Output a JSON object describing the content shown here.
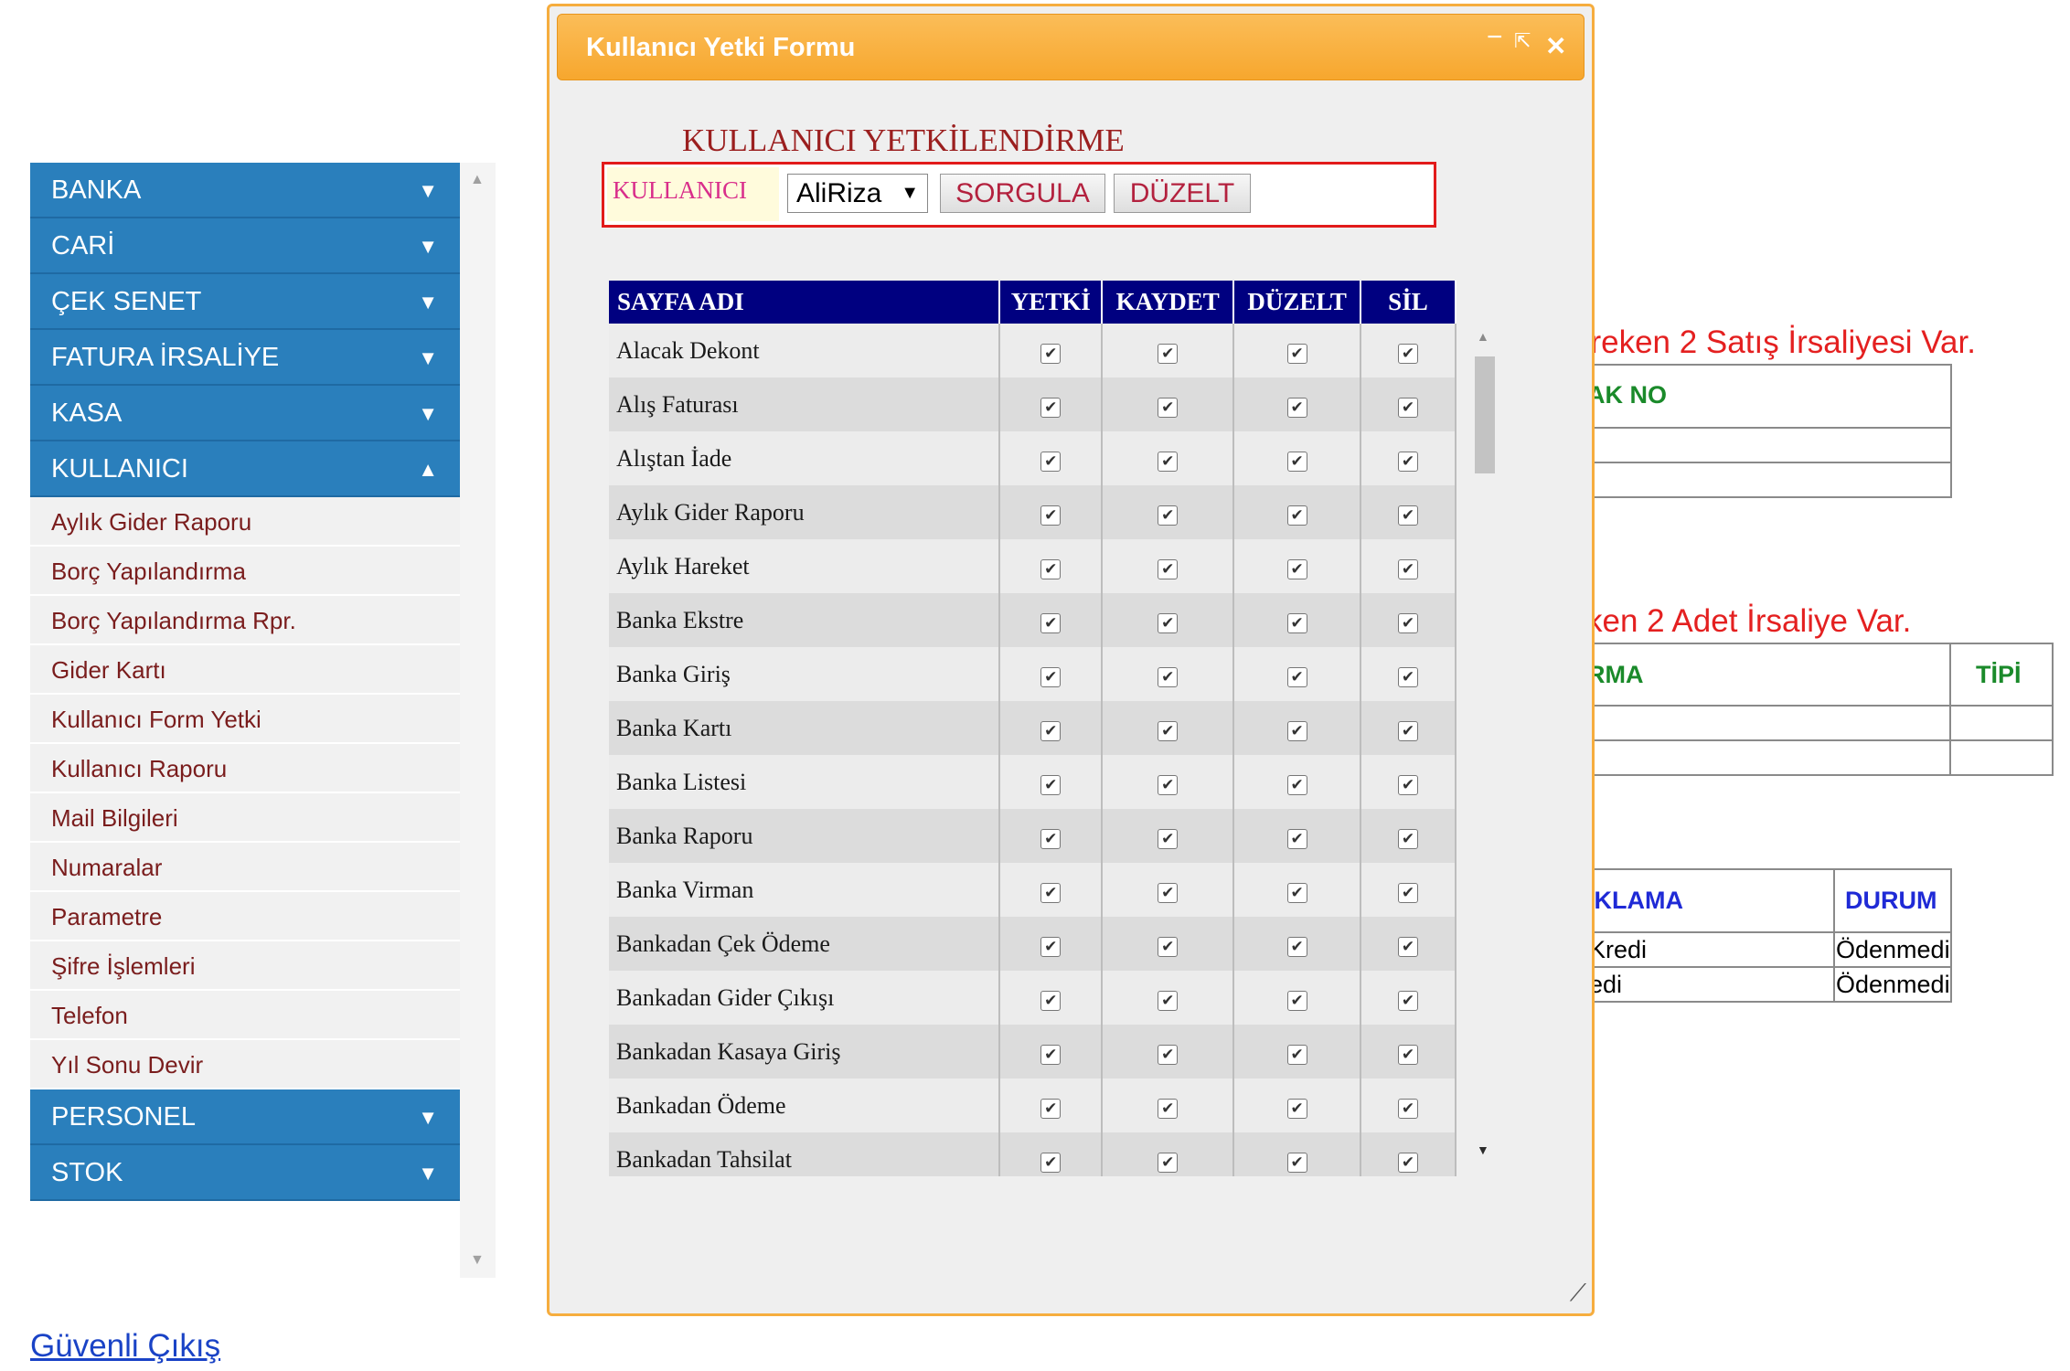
{
  "menu": {
    "sections_top": [
      {
        "label": "BANKA",
        "arrow": "▼"
      },
      {
        "label": "CARİ",
        "arrow": "▼"
      },
      {
        "label": "ÇEK SENET",
        "arrow": "▼"
      },
      {
        "label": "FATURA İRSALİYE",
        "arrow": "▼"
      },
      {
        "label": "KASA",
        "arrow": "▼"
      },
      {
        "label": "KULLANICI",
        "arrow": "▲"
      }
    ],
    "sub_items": [
      "Aylık Gider Raporu",
      "Borç Yapılandırma",
      "Borç Yapılandırma Rpr.",
      "Gider Kartı",
      "Kullanıcı Form Yetki",
      "Kullanıcı Raporu",
      "Mail Bilgileri",
      "Numaralar",
      "Parametre",
      "Şifre İşlemleri",
      "Telefon",
      "Yıl Sonu Devir"
    ],
    "sections_bottom": [
      {
        "label": "PERSONEL",
        "arrow": "▼"
      },
      {
        "label": "STOK",
        "arrow": "▼"
      }
    ]
  },
  "logout": "Güvenli Çıkış",
  "background": {
    "msg1": "ereken 2 Satış İrsaliyesi Var.",
    "table1_header": "AK NO",
    "msg2": "ken 2 Adet İrsaliye Var.",
    "table2_headers": [
      "RMA",
      "TİPİ"
    ],
    "table3_headers": [
      "IKLAMA",
      "DURUM"
    ],
    "table3_rows": [
      [
        "Kredi",
        "Ödenmedi"
      ],
      [
        "edi",
        "Ödenmedi"
      ]
    ],
    "colors": {
      "msg": "#e42020",
      "green_header": "#1a8a2a",
      "blue_header": "#1f2ad6"
    }
  },
  "dialog": {
    "title": "Kullanıcı Yetki Formu",
    "controls": {
      "minimize": "−",
      "popout": "⇱",
      "close": "✕"
    },
    "heading": "KULLANICI YETKİLENDİRME",
    "filter": {
      "label": "KULLANICI",
      "selected_user": "AliRiza",
      "query_button": "SORGULA",
      "edit_button": "DÜZELT"
    },
    "grid": {
      "columns": [
        "SAYFA ADI",
        "YETKİ",
        "KAYDET",
        "DÜZELT",
        "SİL"
      ],
      "rows": [
        {
          "name": "Alacak Dekont",
          "checks": [
            true,
            true,
            true,
            true
          ]
        },
        {
          "name": "Alış Faturası",
          "checks": [
            true,
            true,
            true,
            true
          ]
        },
        {
          "name": "Alıştan İade",
          "checks": [
            true,
            true,
            true,
            true
          ]
        },
        {
          "name": "Aylık Gider Raporu",
          "checks": [
            true,
            true,
            true,
            true
          ]
        },
        {
          "name": "Aylık Hareket",
          "checks": [
            true,
            true,
            true,
            true
          ]
        },
        {
          "name": "Banka Ekstre",
          "checks": [
            true,
            true,
            true,
            true
          ]
        },
        {
          "name": "Banka Giriş",
          "checks": [
            true,
            true,
            true,
            true
          ]
        },
        {
          "name": "Banka Kartı",
          "checks": [
            true,
            true,
            true,
            true
          ]
        },
        {
          "name": "Banka Listesi",
          "checks": [
            true,
            true,
            true,
            true
          ]
        },
        {
          "name": "Banka Raporu",
          "checks": [
            true,
            true,
            true,
            true
          ]
        },
        {
          "name": "Banka Virman",
          "checks": [
            true,
            true,
            true,
            true
          ]
        },
        {
          "name": "Bankadan Çek Ödeme",
          "checks": [
            true,
            true,
            true,
            true
          ]
        },
        {
          "name": "Bankadan Gider Çıkışı",
          "checks": [
            true,
            true,
            true,
            true
          ]
        },
        {
          "name": "Bankadan Kasaya Giriş",
          "checks": [
            true,
            true,
            true,
            true
          ]
        },
        {
          "name": "Bankadan Ödeme",
          "checks": [
            true,
            true,
            true,
            true
          ]
        },
        {
          "name": "Bankadan Tahsilat",
          "checks": [
            true,
            true,
            true,
            true
          ]
        }
      ]
    },
    "colors": {
      "title_bar": "#f7a72e",
      "grid_header": "#000080",
      "heading": "#9b1f1f"
    }
  }
}
